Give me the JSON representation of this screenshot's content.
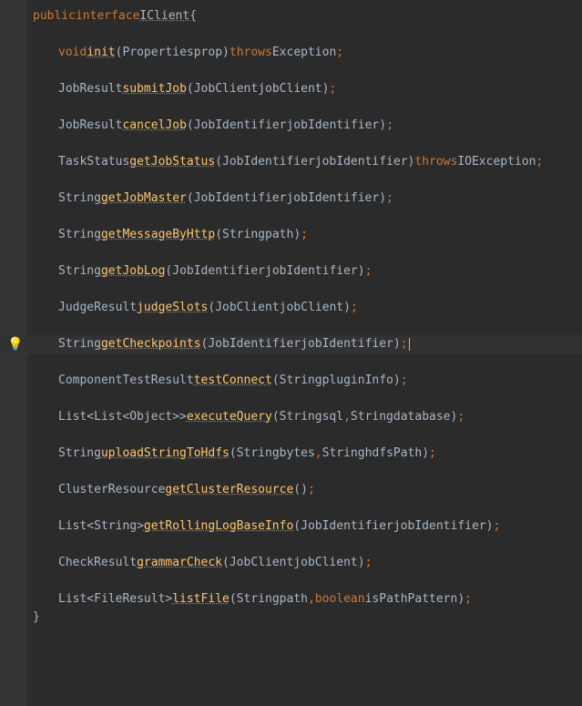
{
  "declaration": {
    "modifier": "public",
    "keyword": "interface",
    "name": "IClient",
    "open": "{",
    "close": "}"
  },
  "lines": [
    {
      "type": "decl"
    },
    {
      "type": "blank"
    },
    {
      "type": "method",
      "i": 0
    },
    {
      "type": "blank"
    },
    {
      "type": "method",
      "i": 1
    },
    {
      "type": "blank"
    },
    {
      "type": "method",
      "i": 2
    },
    {
      "type": "blank"
    },
    {
      "type": "method",
      "i": 3
    },
    {
      "type": "blank"
    },
    {
      "type": "method",
      "i": 4
    },
    {
      "type": "blank"
    },
    {
      "type": "method",
      "i": 5
    },
    {
      "type": "blank"
    },
    {
      "type": "method",
      "i": 6
    },
    {
      "type": "blank"
    },
    {
      "type": "method",
      "i": 7
    },
    {
      "type": "blank"
    },
    {
      "type": "method",
      "i": 8,
      "highlight": true,
      "bulb": true,
      "caret": true
    },
    {
      "type": "blank"
    },
    {
      "type": "method",
      "i": 9
    },
    {
      "type": "blank"
    },
    {
      "type": "method",
      "i": 10
    },
    {
      "type": "blank"
    },
    {
      "type": "method",
      "i": 11
    },
    {
      "type": "blank"
    },
    {
      "type": "method",
      "i": 12
    },
    {
      "type": "blank"
    },
    {
      "type": "method",
      "i": 13
    },
    {
      "type": "blank"
    },
    {
      "type": "method",
      "i": 14
    },
    {
      "type": "blank"
    },
    {
      "type": "method",
      "i": 15
    },
    {
      "type": "close"
    }
  ],
  "methods": [
    {
      "ret_kw": "void",
      "ret": "",
      "name": "init",
      "params": [
        {
          "t": "Properties",
          "n": "prop"
        }
      ],
      "throws": "Exception"
    },
    {
      "ret": "JobResult",
      "name": "submitJob",
      "params": [
        {
          "t": "JobClient",
          "n": "jobClient"
        }
      ]
    },
    {
      "ret": "JobResult",
      "name": "cancelJob",
      "params": [
        {
          "t": "JobIdentifier",
          "n": "jobIdentifier"
        }
      ]
    },
    {
      "ret": "TaskStatus",
      "name": "getJobStatus",
      "params": [
        {
          "t": "JobIdentifier",
          "n": "jobIdentifier"
        }
      ],
      "throws": "IOException"
    },
    {
      "ret": "String",
      "name": "getJobMaster",
      "params": [
        {
          "t": "JobIdentifier",
          "n": "jobIdentifier"
        }
      ]
    },
    {
      "ret": "String",
      "name": "getMessageByHttp",
      "params": [
        {
          "t": "String",
          "n": "path"
        }
      ]
    },
    {
      "ret": "String",
      "name": "getJobLog",
      "params": [
        {
          "t": "JobIdentifier",
          "n": "jobIdentifier"
        }
      ]
    },
    {
      "ret": "JudgeResult",
      "name": "judgeSlots",
      "params": [
        {
          "t": "JobClient",
          "n": "jobClient"
        }
      ]
    },
    {
      "ret": "String",
      "name": "getCheckpoints",
      "params": [
        {
          "t": "JobIdentifier",
          "n": "jobIdentifier"
        }
      ]
    },
    {
      "ret": "ComponentTestResult",
      "name": "testConnect",
      "params": [
        {
          "t": "String",
          "n": "pluginInfo"
        }
      ]
    },
    {
      "ret": "List<List<Object>>",
      "name": "executeQuery",
      "params": [
        {
          "t": "String",
          "n": "sql"
        },
        {
          "t": "String",
          "n": "database"
        }
      ]
    },
    {
      "ret": "String",
      "name": "uploadStringToHdfs",
      "params": [
        {
          "t": "String",
          "n": "bytes"
        },
        {
          "t": "",
          "sp": true,
          "t2": "String",
          "n": "hdfsPath"
        }
      ]
    },
    {
      "ret": "ClusterResource",
      "name": "getClusterResource",
      "params": []
    },
    {
      "ret": "List<String>",
      "name": "getRollingLogBaseInfo",
      "params": [
        {
          "t": "JobIdentifier",
          "n": "jobIdentifier"
        }
      ]
    },
    {
      "ret": "CheckResult",
      "name": "grammarCheck",
      "params": [
        {
          "t": "JobClient",
          "n": "jobClient"
        }
      ]
    },
    {
      "ret": "List<FileResult>",
      "name": "listFile",
      "params": [
        {
          "t": "String",
          "n": "path"
        },
        {
          "kw": "boolean",
          "n": "isPathPattern"
        }
      ]
    }
  ],
  "tokens": {
    "throws": "throws",
    "lparen": "(",
    "rparen": ")",
    "semi": ";",
    "comma": ",",
    "space": " "
  },
  "icons": {
    "bulb": "💡"
  }
}
